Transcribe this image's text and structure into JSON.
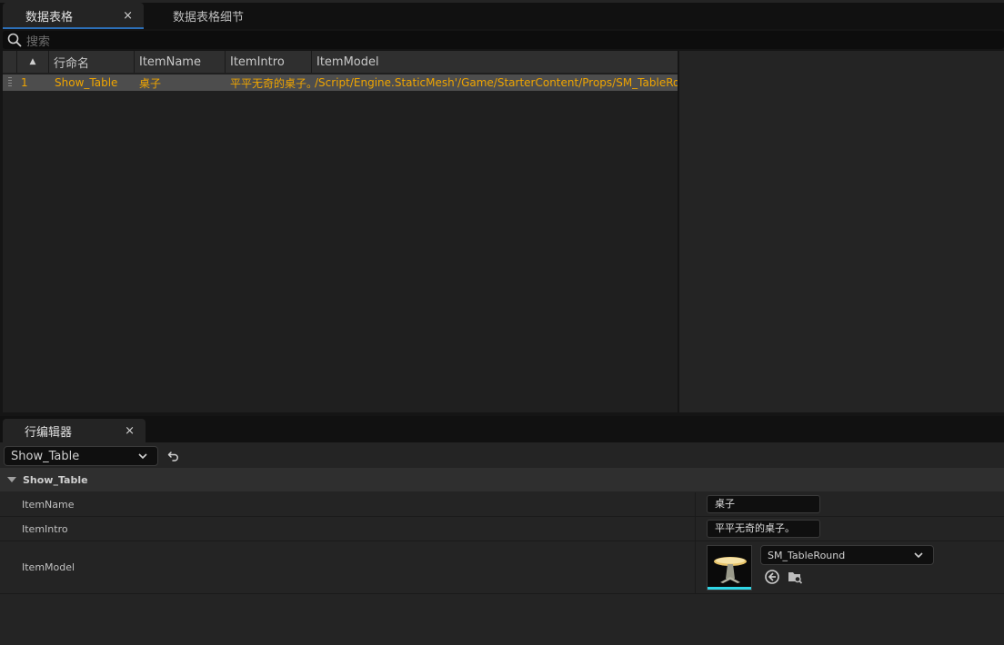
{
  "tabs": {
    "data_table": "数据表格",
    "data_table_details": "数据表格细节",
    "close_glyph": "×"
  },
  "search": {
    "placeholder": "搜索"
  },
  "table": {
    "headers": {
      "rowname": "行命名",
      "col1": "ItemName",
      "col2": "ItemIntro",
      "col3": "ItemModel"
    },
    "rows": [
      {
        "index": "1",
        "rowname": "Show_Table",
        "ItemName": "桌子",
        "ItemIntro": "平平无奇的桌子。",
        "ItemModel": "/Script/Engine.StaticMesh'/Game/StarterContent/Props/SM_TableRound"
      }
    ],
    "highlight_color": "#f0a500"
  },
  "row_editor": {
    "tab_label": "行编辑器",
    "selected_row": "Show_Table",
    "section_title": "Show_Table",
    "props": {
      "item_name_label": "ItemName",
      "item_name_value": "桌子",
      "item_intro_label": "ItemIntro",
      "item_intro_value": "平平无奇的桌子。",
      "item_model_label": "ItemModel",
      "item_model_value": "SM_TableRound"
    }
  }
}
